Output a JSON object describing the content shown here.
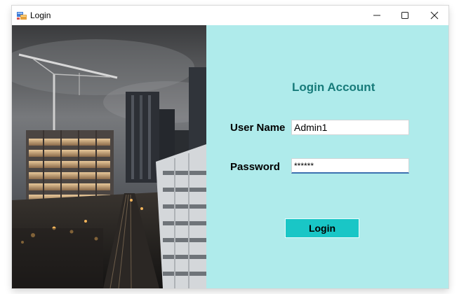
{
  "window": {
    "title": "Login",
    "controls": {
      "minimize": "minimize-icon",
      "maximize": "maximize-icon",
      "close": "close-icon"
    }
  },
  "panel": {
    "heading": "Login Account",
    "background": "#afebeb",
    "heading_color": "#177b7a",
    "username": {
      "label": "User Name",
      "value": "Admin1"
    },
    "password": {
      "label": "Password",
      "value": "******"
    },
    "login_button": {
      "label": "Login",
      "color": "#19c6c6"
    }
  },
  "photo": {
    "subject": "city-skyline-photo"
  }
}
